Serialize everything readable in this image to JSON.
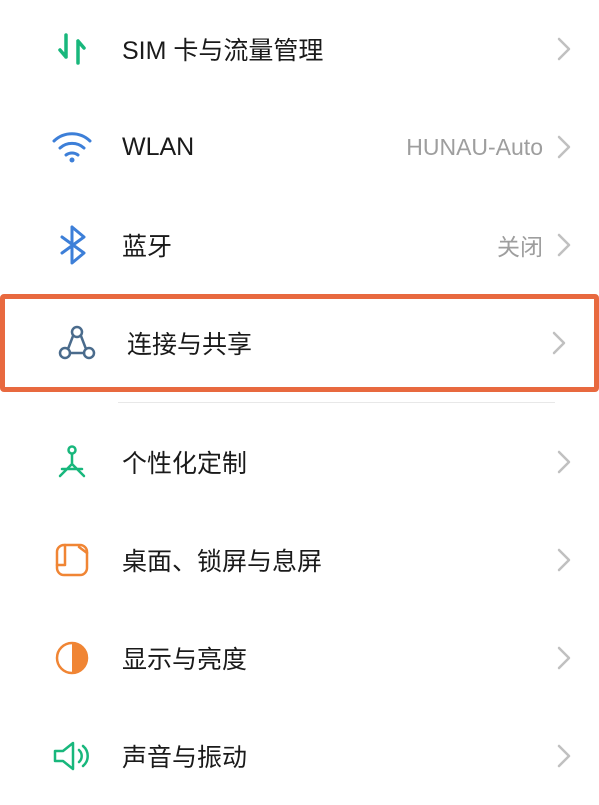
{
  "settings": {
    "items": [
      {
        "id": "sim-data",
        "label": "SIM 卡与流量管理",
        "value": "",
        "icon_color": "#18B77C",
        "highlighted": false
      },
      {
        "id": "wlan",
        "label": "WLAN",
        "value": "HUNAU-Auto",
        "icon_color": "#3D7FD8",
        "highlighted": false
      },
      {
        "id": "bluetooth",
        "label": "蓝牙",
        "value": "关闭",
        "icon_color": "#3D7FD8",
        "highlighted": false
      },
      {
        "id": "connection-sharing",
        "label": "连接与共享",
        "value": "",
        "icon_color": "#4A6B8C",
        "highlighted": true
      },
      {
        "id": "personalization",
        "label": "个性化定制",
        "value": "",
        "icon_color": "#18B77C",
        "highlighted": false
      },
      {
        "id": "desktop-lockscreen",
        "label": "桌面、锁屏与息屏",
        "value": "",
        "icon_color": "#F08534",
        "highlighted": false
      },
      {
        "id": "display-brightness",
        "label": "显示与亮度",
        "value": "",
        "icon_color": "#F08534",
        "highlighted": false
      },
      {
        "id": "sound-vibration",
        "label": "声音与振动",
        "value": "",
        "icon_color": "#18B77C",
        "highlighted": false
      }
    ]
  }
}
